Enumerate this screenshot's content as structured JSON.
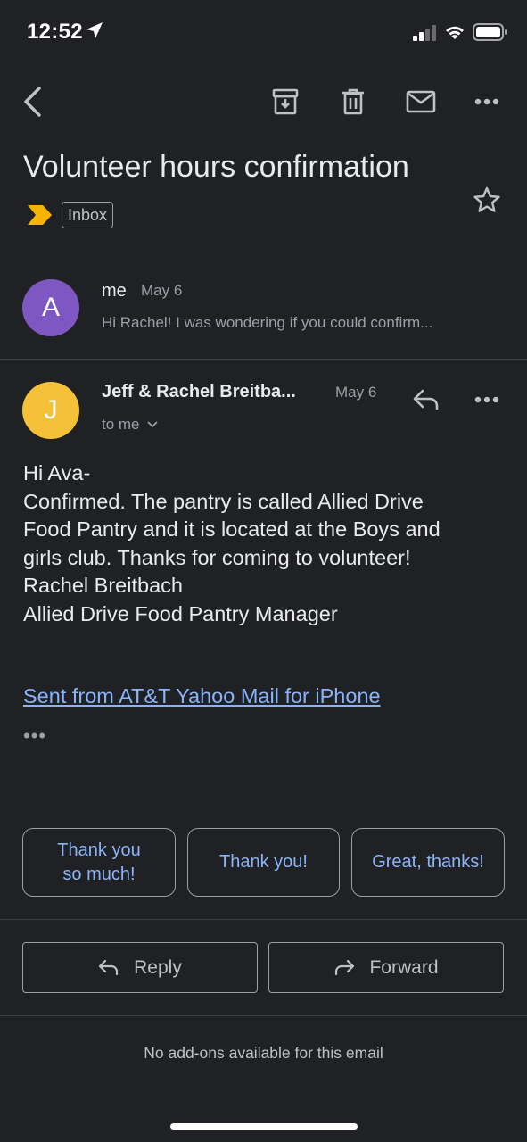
{
  "status_bar": {
    "time": "12:52"
  },
  "email": {
    "subject": "Volunteer hours confirmation",
    "label": "Inbox"
  },
  "messages": [
    {
      "avatar_letter": "A",
      "avatar_color": "#7e57c2",
      "sender": "me",
      "date": "May 6",
      "snippet": "Hi Rachel! I was wondering if you could confirm..."
    },
    {
      "avatar_letter": "J",
      "avatar_color": "#f4c138",
      "sender": "Jeff & Rachel Breitba...",
      "date": "May 6",
      "recipient": "to me",
      "body": [
        "Hi Ava-",
        "Confirmed. The pantry is called Allied Drive",
        "Food Pantry and it is located at the Boys and",
        "girls club. Thanks for coming to volunteer!",
        "Rachel Breitbach",
        "Allied Drive Food Pantry Manager"
      ],
      "signature_link": "Sent from AT&T Yahoo Mail for iPhone",
      "trimmed_content": "•••"
    }
  ],
  "smart_replies": [
    {
      "line1": "Thank you",
      "line2": "so much!"
    },
    {
      "line1": "Thank you!",
      "line2": ""
    },
    {
      "line1": "Great, thanks!",
      "line2": ""
    }
  ],
  "actions": {
    "reply": "Reply",
    "forward": "Forward"
  },
  "footer": {
    "addons": "No add-ons available for this email"
  },
  "colors": {
    "accent_link": "#8ab4f8",
    "importance": "#f4b400",
    "background": "#202124"
  }
}
